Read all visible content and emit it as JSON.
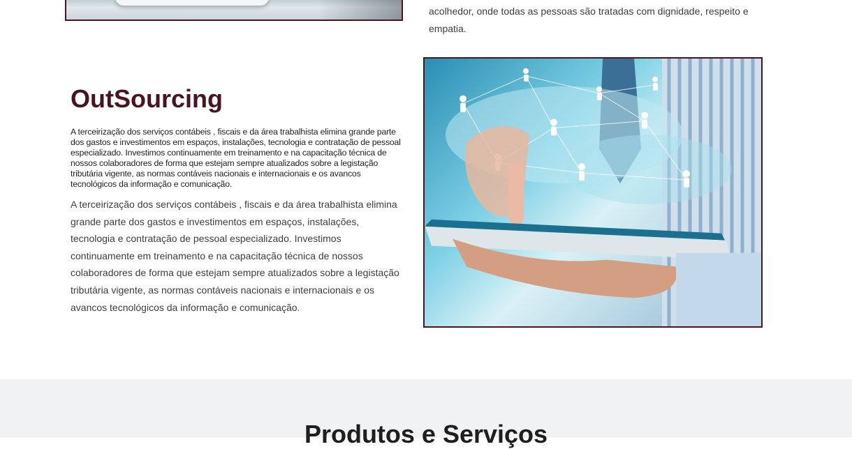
{
  "top_text": "acolhedor, onde todas as pessoas são tratadas com dignidade, respeito e empatia.",
  "outsourcing": {
    "heading": "OutSourcing",
    "small_paragraph": "A terceirização dos serviços contábeis , fiscais e da área trabalhista elimina grande parte dos gastos e investimentos em espaços, instalações, tecnologia e contratação de pessoal especializado. Investimos continuamente em treinamento e na capacitação técnica de nossos colaboradores de forma que estejam sempre atualizados sobre a legistação tributária vigente, as normas contáveis nacionais e internacionais e os avancos tecnológicos da informação e comunicação.",
    "paragraph": "A terceirização dos serviços contábeis , fiscais e da área trabalhista elimina grande parte dos gastos e investimentos em espaços, instalações, tecnologia e contratação de pessoal especializado. Investimos continuamente em treinamento e na capacitação técnica de nossos colaboradores de forma que estejam sempre atualizados sobre a legistação tributária vigente, as normas contáveis nacionais e internacionais e os avancos tecnológicos da informação e comunicação."
  },
  "products_section": {
    "title": "Produtos e Serviços"
  },
  "colors": {
    "accent": "#4a1320",
    "band": "#f1f2f3"
  }
}
